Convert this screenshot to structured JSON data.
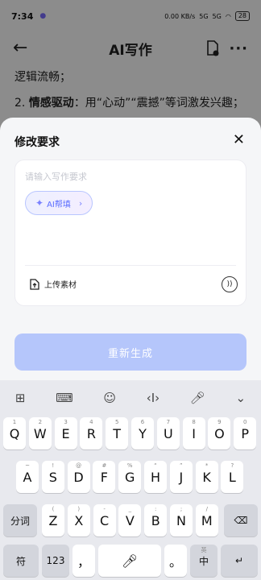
{
  "status": {
    "time": "7:34",
    "net": "0.00 KB/s",
    "signal1": "5G",
    "signal2": "5G",
    "battery": "28"
  },
  "header": {
    "title": "AI写作"
  },
  "content": {
    "line1": "逻辑流畅；",
    "line2_num": "2.",
    "line2_bold": "情感驱动",
    "line2_rest": "：用“心动”“震撼”等词激发兴趣；"
  },
  "sheet": {
    "title": "修改要求",
    "input": {
      "placeholder": "请输入写作要求",
      "value": ""
    },
    "ai_chip_label": "AI帮填",
    "upload_label": "上传素材",
    "regenerate_label": "重新生成"
  },
  "keyboard": {
    "toolbar_icons": [
      "grid-icon",
      "keyboard-icon",
      "emoji-icon",
      "cursor-icon",
      "mic-icon",
      "collapse-icon"
    ],
    "row1": [
      [
        "Q",
        "1"
      ],
      [
        "W",
        "2"
      ],
      [
        "E",
        "3"
      ],
      [
        "R",
        "4"
      ],
      [
        "T",
        "5"
      ],
      [
        "Y",
        "6"
      ],
      [
        "U",
        "7"
      ],
      [
        "I",
        "8"
      ],
      [
        "O",
        "9"
      ],
      [
        "P",
        "0"
      ]
    ],
    "row2": [
      [
        "A",
        "~"
      ],
      [
        "S",
        "!"
      ],
      [
        "D",
        "@"
      ],
      [
        "F",
        "#"
      ],
      [
        "G",
        "%"
      ],
      [
        "H",
        "“"
      ],
      [
        "J",
        "”"
      ],
      [
        "K",
        "*"
      ],
      [
        "L",
        "?"
      ]
    ],
    "row3": [
      [
        "Z",
        "("
      ],
      [
        "X",
        ")"
      ],
      [
        "C",
        "-"
      ],
      [
        "V",
        "_"
      ],
      [
        "B",
        ":"
      ],
      [
        "N",
        ";"
      ],
      [
        "M",
        "/"
      ]
    ],
    "split_label": "分词",
    "symbol_label": "符",
    "num_label": "123",
    "comma": "，",
    "period": "。",
    "lang_label": "中",
    "lang_sub": "英"
  }
}
